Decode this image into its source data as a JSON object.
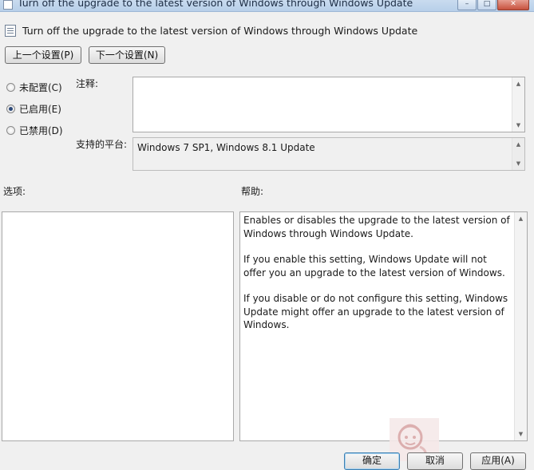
{
  "window": {
    "title": "Turn off the upgrade to the latest version of Windows through Windows Update",
    "controls": [
      "–",
      "□",
      "✕"
    ]
  },
  "policy": {
    "heading": "Turn off the upgrade to the latest version of Windows through Windows Update"
  },
  "nav": {
    "prev_label": "上一个设置(P)",
    "next_label": "下一个设置(N)"
  },
  "state": {
    "options": [
      {
        "label": "未配置(C)",
        "checked": false
      },
      {
        "label": "已启用(E)",
        "checked": true
      },
      {
        "label": "已禁用(D)",
        "checked": false
      }
    ]
  },
  "comment": {
    "label": "注释:",
    "value": ""
  },
  "platform": {
    "label": "支持的平台:",
    "value": "Windows 7 SP1, Windows 8.1 Update"
  },
  "options_panel": {
    "label": "选项:"
  },
  "help_panel": {
    "label": "帮助:",
    "paragraphs": [
      "Enables or disables the upgrade to the latest version of Windows through Windows Update.",
      "If you enable this setting, Windows Update will not offer you an upgrade to the latest version of Windows.",
      "If you disable or do not configure this setting, Windows Update might offer an upgrade to the latest version of Windows."
    ]
  },
  "footer": {
    "ok_label": "确定",
    "cancel_label": "取消",
    "apply_label": "应用(A)"
  }
}
